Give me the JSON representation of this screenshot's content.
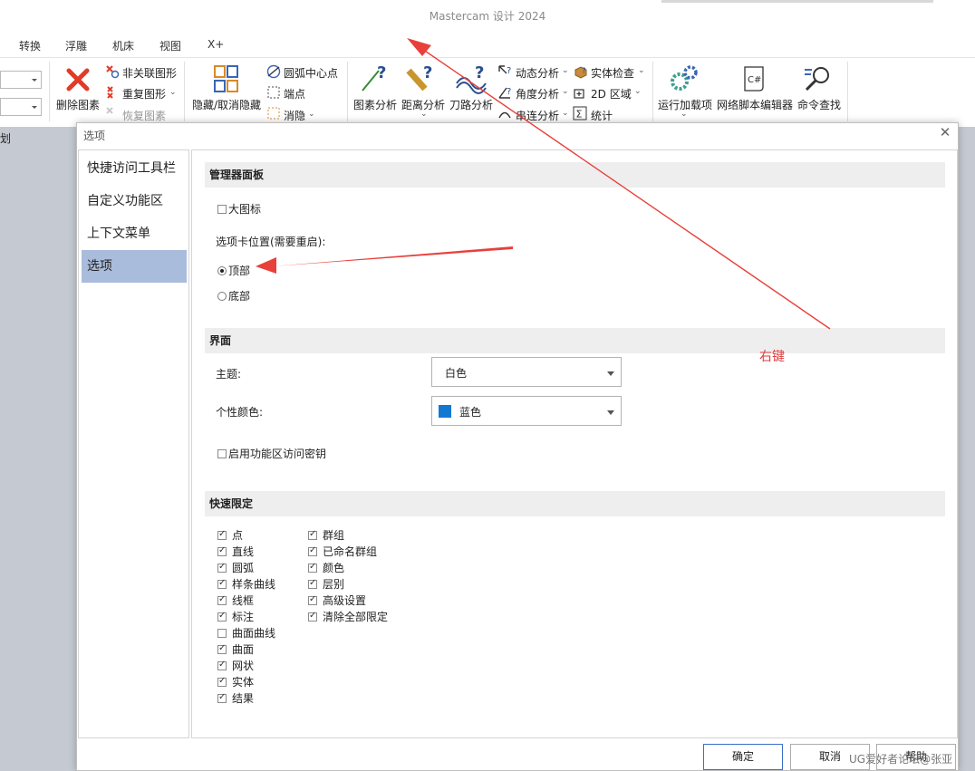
{
  "app": {
    "title": "Mastercam 设计 2024"
  },
  "menu": [
    "转换",
    "浮雕",
    "机床",
    "视图",
    "X+"
  ],
  "ribbon": {
    "fragment_label": "划",
    "delete_entity": "删除图素",
    "unassociated": "非关联图形",
    "duplicate": "重复图形",
    "restore": "恢复图素",
    "hide_unhide": "隐藏/取消隐藏",
    "arc_center": "圆弧中心点",
    "endpoint": "端点",
    "blank": "消隐",
    "entity_analysis": "图素分析",
    "distance_analysis": "距离分析",
    "toolpath_analysis": "刀路分析",
    "dynamic_analysis": "动态分析",
    "angle_analysis": "角度分析",
    "chain_analysis": "串连分析",
    "solid_check": "实体检查",
    "area_2d": "2D 区域",
    "statistics": "统计",
    "run_addin": "运行加载项",
    "net_script_editor": "网络脚本编辑器",
    "command_finder": "命令查找",
    "csharp_icon_text": "C#"
  },
  "dialog": {
    "title": "选项",
    "nav": [
      "快捷访问工具栏",
      "自定义功能区",
      "上下文菜单",
      "选项"
    ],
    "active_nav": 3,
    "manager": {
      "header": "管理器面板",
      "large_icons": "大图标",
      "tab_position_label": "选项卡位置(需要重启):",
      "top": "顶部",
      "bottom": "底部",
      "selected": "top"
    },
    "interface": {
      "header": "界面",
      "theme_label": "主题:",
      "theme_value": "白色",
      "color_label": "个性颜色:",
      "color_value": "蓝色",
      "color_swatch": "#1279d2",
      "ribbon_keytips": "启用功能区访问密钥"
    },
    "quick_mask": {
      "header": "快速限定",
      "left": [
        {
          "label": "点",
          "checked": true
        },
        {
          "label": "直线",
          "checked": true
        },
        {
          "label": "圆弧",
          "checked": true
        },
        {
          "label": "样条曲线",
          "checked": true
        },
        {
          "label": "线框",
          "checked": true
        },
        {
          "label": "标注",
          "checked": true
        },
        {
          "label": "曲面曲线",
          "checked": false
        },
        {
          "label": "曲面",
          "checked": true
        },
        {
          "label": "网状",
          "checked": true
        },
        {
          "label": "实体",
          "checked": true
        },
        {
          "label": "结果",
          "checked": true
        }
      ],
      "right": [
        {
          "label": "群组",
          "checked": true
        },
        {
          "label": "已命名群组",
          "checked": true
        },
        {
          "label": "颜色",
          "checked": true
        },
        {
          "label": "层别",
          "checked": true
        },
        {
          "label": "高级设置",
          "checked": true
        },
        {
          "label": "清除全部限定",
          "checked": true
        }
      ]
    },
    "buttons": {
      "ok": "确定",
      "cancel": "取消",
      "help": "帮助"
    }
  },
  "annotation": {
    "text": "右键",
    "color": "#e03a3a"
  },
  "watermark": "UG爱好者论坛@张亚"
}
